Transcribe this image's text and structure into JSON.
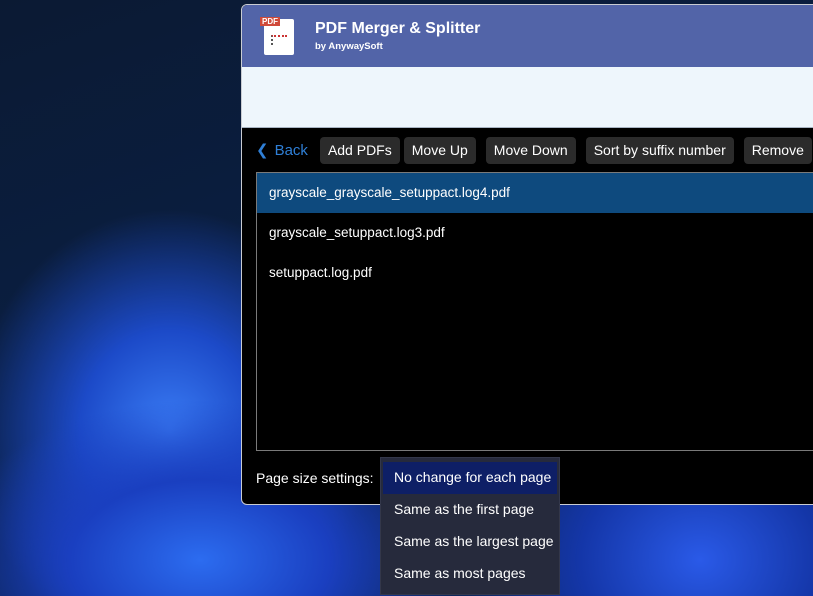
{
  "app": {
    "title": "PDF Merger & Splitter",
    "subtitle": "by AnywaySoft",
    "logo_text": "PDF"
  },
  "toolbar": {
    "back": "Back",
    "add": "Add PDFs",
    "up": "Move Up",
    "down": "Move Down",
    "sort": "Sort by suffix number",
    "remove": "Remove"
  },
  "files": [
    "grayscale_grayscale_setuppact.log4.pdf",
    "grayscale_setuppact.log3.pdf",
    "setuppact.log.pdf"
  ],
  "page_size": {
    "label": "Page size settings:",
    "options": [
      "No change for each page",
      "Same as the first page",
      "Same as the largest page",
      "Same as most pages"
    ],
    "selected": "No change for each page"
  }
}
